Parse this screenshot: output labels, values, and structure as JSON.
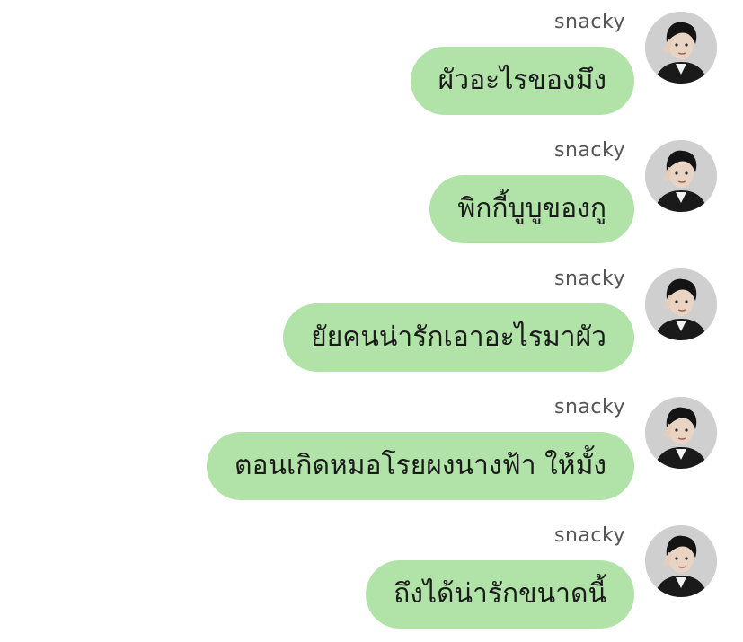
{
  "chat": {
    "messages": [
      {
        "sender": "snacky",
        "text": "ผัวอะไรของมึง",
        "avatar_icon": "user-avatar-icon"
      },
      {
        "sender": "snacky",
        "text": "พิกกี้บูบูของกู",
        "avatar_icon": "user-avatar-icon"
      },
      {
        "sender": "snacky",
        "text": "ยัยคนน่ารักเอาอะไรมาผัว",
        "avatar_icon": "user-avatar-icon"
      },
      {
        "sender": "snacky",
        "text": "ตอนเกิดหมอโรยผงนางฟ้า ให้มั้ง",
        "avatar_icon": "user-avatar-icon"
      },
      {
        "sender": "snacky",
        "text": "ถึงได้น่ารักขนาดนี้",
        "avatar_icon": "user-avatar-icon"
      }
    ]
  },
  "colors": {
    "bubble": "#b1e3a9",
    "sender_text": "#555555",
    "message_text": "#1b1b1b",
    "background": "#ffffff"
  }
}
